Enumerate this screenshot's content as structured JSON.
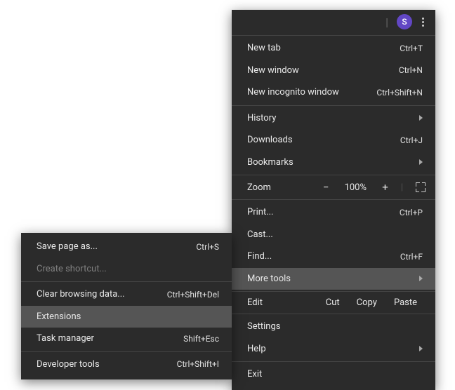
{
  "header": {
    "avatar_letter": "S"
  },
  "main_menu": {
    "new_tab": {
      "label": "New tab",
      "shortcut": "Ctrl+T"
    },
    "new_window": {
      "label": "New window",
      "shortcut": "Ctrl+N"
    },
    "new_incognito": {
      "label": "New incognito window",
      "shortcut": "Ctrl+Shift+N"
    },
    "history": {
      "label": "History"
    },
    "downloads": {
      "label": "Downloads",
      "shortcut": "Ctrl+J"
    },
    "bookmarks": {
      "label": "Bookmarks"
    },
    "zoom": {
      "label": "Zoom",
      "minus": "−",
      "value": "100%",
      "plus": "+"
    },
    "print": {
      "label": "Print...",
      "shortcut": "Ctrl+P"
    },
    "cast": {
      "label": "Cast..."
    },
    "find": {
      "label": "Find...",
      "shortcut": "Ctrl+F"
    },
    "more_tools": {
      "label": "More tools"
    },
    "edit": {
      "label": "Edit",
      "cut": "Cut",
      "copy": "Copy",
      "paste": "Paste"
    },
    "settings": {
      "label": "Settings"
    },
    "help": {
      "label": "Help"
    },
    "exit": {
      "label": "Exit"
    }
  },
  "sub_menu": {
    "save_page": {
      "label": "Save page as...",
      "shortcut": "Ctrl+S"
    },
    "create_shortcut": {
      "label": "Create shortcut..."
    },
    "clear_browsing": {
      "label": "Clear browsing data...",
      "shortcut": "Ctrl+Shift+Del"
    },
    "extensions": {
      "label": "Extensions"
    },
    "task_manager": {
      "label": "Task manager",
      "shortcut": "Shift+Esc"
    },
    "developer_tools": {
      "label": "Developer tools",
      "shortcut": "Ctrl+Shift+I"
    }
  }
}
